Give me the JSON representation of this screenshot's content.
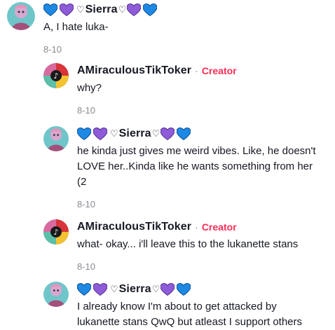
{
  "comments": [
    {
      "author": {
        "prefix_hearts": [
          "blue",
          "purple"
        ],
        "name": "Sierra",
        "suffix_hearts": [
          "purple",
          "blue"
        ],
        "small_heart": "♡"
      },
      "text": "A, I hate luka-",
      "date": "8-10"
    },
    {
      "author": {
        "name": "AMiraculousTikToker",
        "separator": "·",
        "badge": "Creator"
      },
      "text": "why?",
      "date": "8-10"
    },
    {
      "author": {
        "prefix_hearts": [
          "blue",
          "purple"
        ],
        "name": "Sierra",
        "suffix_hearts": [
          "purple",
          "blue"
        ],
        "small_heart": "♡"
      },
      "text_lines": [
        "he kinda just gives me weird vibes. Like, he doesn't",
        "LOVE her..Kinda like he wants something from her",
        "(2"
      ],
      "date": "8-10"
    },
    {
      "author": {
        "name": "AMiraculousTikToker",
        "separator": "·",
        "badge": "Creator"
      },
      "text": "what- okay... i'll leave this to the lukanette stans",
      "date": "8-10"
    },
    {
      "author": {
        "prefix_hearts": [
          "blue",
          "purple"
        ],
        "name": "Sierra",
        "suffix_hearts": [
          "purple",
          "blue"
        ],
        "small_heart": "♡"
      },
      "text_lines": [
        "I already know I'm about to get attacked by",
        "lukanette stans QwQ but atleast I support others"
      ]
    }
  ],
  "colors": {
    "blue_heart": "#1e88e5",
    "purple_heart": "#8e5bd9",
    "creator": "#fe2c55",
    "meta": "#8a8b91"
  }
}
